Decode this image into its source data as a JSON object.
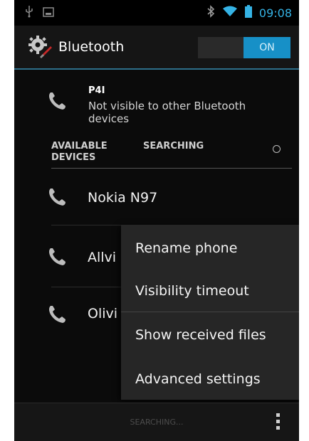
{
  "status_bar": {
    "time": "09:08",
    "icons": [
      "usb-icon",
      "screenshot-icon",
      "bluetooth-icon",
      "wifi-icon",
      "battery-icon"
    ]
  },
  "action_bar": {
    "title": "Bluetooth",
    "toggle_label": "ON"
  },
  "this_device": {
    "name": "P4I",
    "status": "Not visible to other Bluetooth devices"
  },
  "section": {
    "available_label": "AVAILABLE DEVICES",
    "searching_label": "SEARCHING"
  },
  "devices": [
    {
      "name": "Nokia N97"
    },
    {
      "name": "Allvi"
    },
    {
      "name": "Olivi"
    }
  ],
  "menu": {
    "items": [
      {
        "label": "Rename phone"
      },
      {
        "label": "Visibility timeout"
      },
      {
        "label": "Show received files"
      },
      {
        "label": "Advanced settings"
      }
    ]
  },
  "bottom_bar": {
    "status": "SEARCHING..."
  },
  "colors": {
    "accent": "#35b3e5",
    "toggle_on": "#1790c7",
    "background": "#0b0b0b"
  }
}
